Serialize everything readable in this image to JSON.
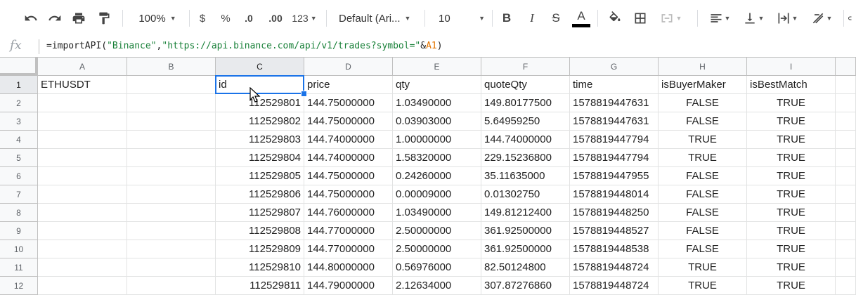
{
  "toolbar": {
    "zoom": "100%",
    "currency": "$",
    "percent": "%",
    "decrease_decimal": ".0",
    "increase_decimal": ".00",
    "more_formats": "123",
    "font": "Default (Ari...",
    "font_size": "10",
    "bold": "B",
    "italic": "I",
    "strike": "S",
    "text_color_letter": "A",
    "text_color": "#000000"
  },
  "formula_bar": {
    "fx": "fx",
    "formula_prefix": "=importAPI(",
    "formula_arg1": "\"Binance\"",
    "formula_comma": ",",
    "formula_arg2": "\"https://api.binance.com/api/v1/trades?symbol=\"",
    "formula_amp": "&",
    "formula_ref": "A1",
    "formula_suffix": ")"
  },
  "grid": {
    "columns": [
      "A",
      "B",
      "C",
      "D",
      "E",
      "F",
      "G",
      "H",
      "I"
    ],
    "rows": [
      "1",
      "2",
      "3",
      "4",
      "5",
      "6",
      "7",
      "8",
      "9",
      "10",
      "11",
      "12"
    ],
    "selected_col": "C",
    "selected_row": "1",
    "cells": [
      [
        "ETHUSDT",
        "",
        "id",
        "price",
        "qty",
        "quoteQty",
        "time",
        "isBuyerMaker",
        "isBestMatch"
      ],
      [
        "",
        "",
        "112529801",
        "144.75000000",
        "1.03490000",
        "149.80177500",
        "1578819447631",
        "FALSE",
        "TRUE"
      ],
      [
        "",
        "",
        "112529802",
        "144.75000000",
        "0.03903000",
        "5.64959250",
        "1578819447631",
        "FALSE",
        "TRUE"
      ],
      [
        "",
        "",
        "112529803",
        "144.74000000",
        "1.00000000",
        "144.74000000",
        "1578819447794",
        "TRUE",
        "TRUE"
      ],
      [
        "",
        "",
        "112529804",
        "144.74000000",
        "1.58320000",
        "229.15236800",
        "1578819447794",
        "TRUE",
        "TRUE"
      ],
      [
        "",
        "",
        "112529805",
        "144.75000000",
        "0.24260000",
        "35.11635000",
        "1578819447955",
        "FALSE",
        "TRUE"
      ],
      [
        "",
        "",
        "112529806",
        "144.75000000",
        "0.00009000",
        "0.01302750",
        "1578819448014",
        "FALSE",
        "TRUE"
      ],
      [
        "",
        "",
        "112529807",
        "144.76000000",
        "1.03490000",
        "149.81212400",
        "1578819448250",
        "FALSE",
        "TRUE"
      ],
      [
        "",
        "",
        "112529808",
        "144.77000000",
        "2.50000000",
        "361.92500000",
        "1578819448527",
        "FALSE",
        "TRUE"
      ],
      [
        "",
        "",
        "112529809",
        "144.77000000",
        "2.50000000",
        "361.92500000",
        "1578819448538",
        "FALSE",
        "TRUE"
      ],
      [
        "",
        "",
        "112529810",
        "144.80000000",
        "0.56976000",
        "82.50124800",
        "1578819448724",
        "TRUE",
        "TRUE"
      ],
      [
        "",
        "",
        "112529811",
        "144.79000000",
        "2.12634000",
        "307.87276860",
        "1578819448724",
        "TRUE",
        "TRUE"
      ]
    ]
  },
  "colors": {
    "selection": "#1a73e8",
    "string_literal": "#188038",
    "cell_reference": "#e37400"
  }
}
